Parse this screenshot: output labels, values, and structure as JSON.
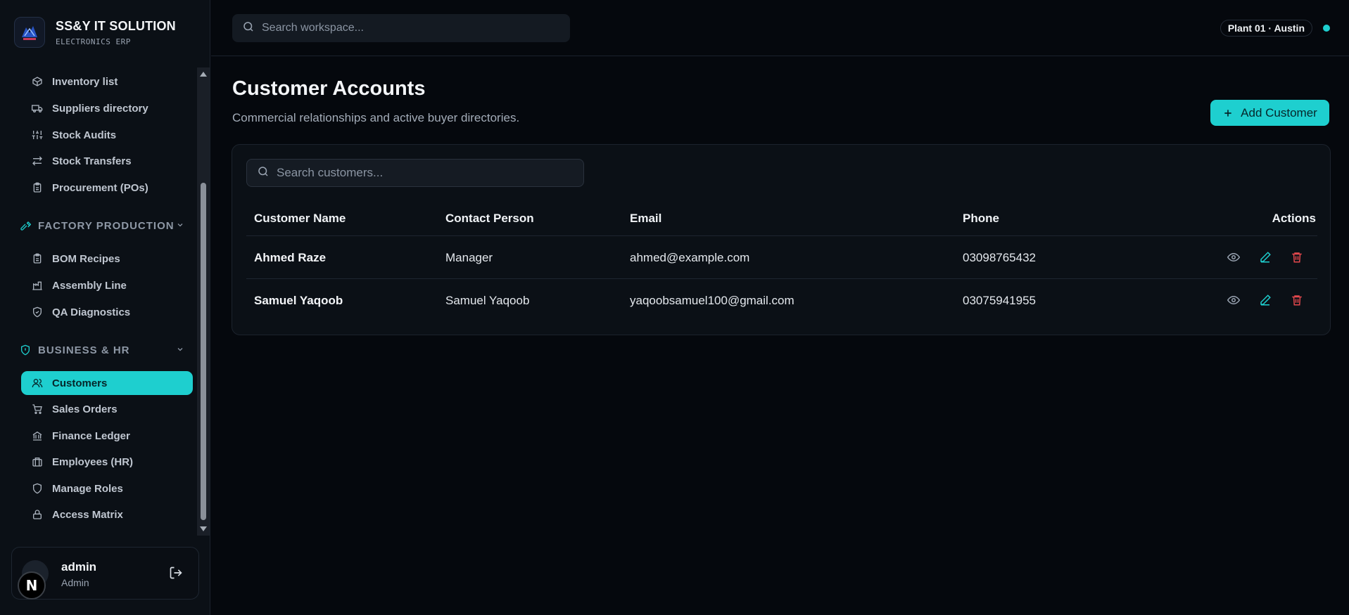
{
  "brand": {
    "title": "SS&Y IT SOLUTION",
    "subtitle": "ELECTRONICS ERP"
  },
  "sidebar": {
    "items_inventory": [
      {
        "label": "Inventory list",
        "icon": "package-icon"
      },
      {
        "label": "Suppliers directory",
        "icon": "truck-icon"
      },
      {
        "label": "Stock Audits",
        "icon": "sliders-icon"
      },
      {
        "label": "Stock Transfers",
        "icon": "arrows-icon"
      },
      {
        "label": "Procurement (POs)",
        "icon": "clipboard-icon"
      }
    ],
    "section_factory": "FACTORY PRODUCTION",
    "items_factory": [
      {
        "label": "BOM Recipes",
        "icon": "clipboard-icon"
      },
      {
        "label": "Assembly Line",
        "icon": "factory-icon"
      },
      {
        "label": "QA Diagnostics",
        "icon": "shield-check-icon"
      }
    ],
    "section_business": "BUSINESS & HR",
    "items_business": [
      {
        "label": "Customers",
        "icon": "users-icon",
        "active": true
      },
      {
        "label": "Sales Orders",
        "icon": "cart-icon"
      },
      {
        "label": "Finance Ledger",
        "icon": "bank-icon"
      },
      {
        "label": "Employees (HR)",
        "icon": "briefcase-icon"
      },
      {
        "label": "Manage Roles",
        "icon": "shield-icon"
      },
      {
        "label": "Access Matrix",
        "icon": "lock-icon"
      }
    ]
  },
  "user": {
    "name": "admin",
    "role": "Admin",
    "badge": "N"
  },
  "topbar": {
    "search_placeholder": "Search workspace...",
    "plant": "Plant 01 · Austin"
  },
  "page": {
    "title": "Customer Accounts",
    "subtitle": "Commercial relationships and active buyer directories.",
    "add_button": "Add Customer"
  },
  "table": {
    "search_placeholder": "Search customers...",
    "headers": {
      "name": "Customer Name",
      "contact": "Contact Person",
      "email": "Email",
      "phone": "Phone",
      "actions": "Actions"
    },
    "rows": [
      {
        "name": "Ahmed Raze",
        "contact": "Manager",
        "email": "ahmed@example.com",
        "phone": "03098765432"
      },
      {
        "name": "Samuel Yaqoob",
        "contact": "Samuel Yaqoob",
        "email": "yaqoobsamuel100@gmail.com",
        "phone": "03075941955"
      }
    ]
  },
  "colors": {
    "accent": "#1ecfcf",
    "danger": "#e5484d",
    "background": "#05080d",
    "panel": "#0b1016"
  }
}
